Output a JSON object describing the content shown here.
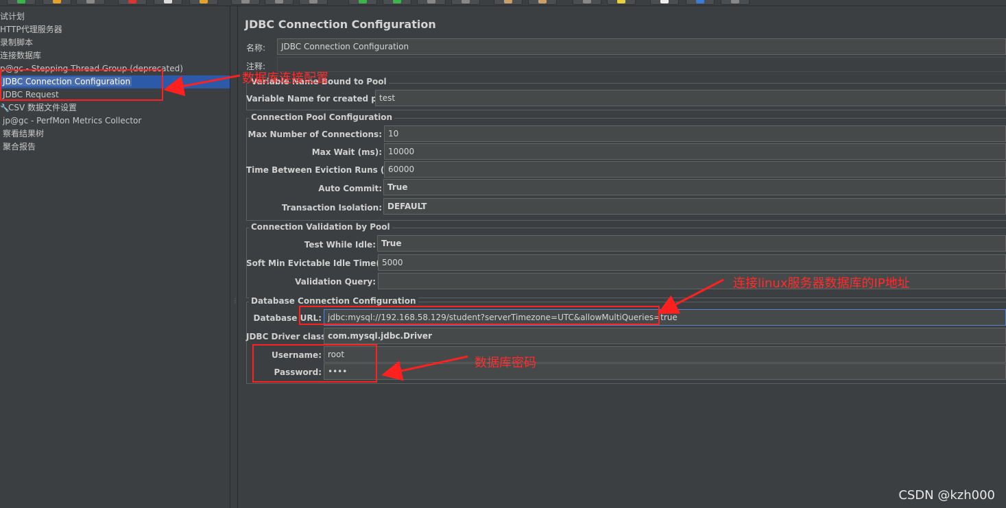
{
  "toolbar": {
    "buttons": [
      {
        "icon": "run-icon",
        "color": "#3bb54a"
      },
      {
        "icon": "folder-icon",
        "color": "#e8a227"
      },
      {
        "icon": "save-icon",
        "color": "#8a8a8a"
      },
      {
        "icon": "cut-icon",
        "color": "#d33"
      },
      {
        "icon": "copy-icon",
        "color": "#ddd"
      },
      {
        "icon": "paste-icon",
        "color": "#e8a227"
      },
      {
        "icon": "expand-icon",
        "color": "#888"
      },
      {
        "icon": "collapse-icon",
        "color": "#888"
      },
      {
        "icon": "toggle-icon",
        "color": "#888"
      },
      {
        "icon": "start-icon",
        "color": "#3bb54a"
      },
      {
        "icon": "start-no-pause-icon",
        "color": "#3bb54a"
      },
      {
        "icon": "stop-icon",
        "color": "#888"
      },
      {
        "icon": "shutdown-icon",
        "color": "#888"
      },
      {
        "icon": "broom-icon",
        "color": "#c9a06a"
      },
      {
        "icon": "clear-all-icon",
        "color": "#c9a06a"
      },
      {
        "icon": "search-icon",
        "color": "#888"
      },
      {
        "icon": "reset-search-icon",
        "color": "#e8d13b"
      },
      {
        "icon": "function-helper-icon",
        "color": "#eee"
      },
      {
        "icon": "help-icon",
        "color": "#3a7bd5"
      },
      {
        "icon": "log-icon",
        "color": "#888"
      }
    ]
  },
  "tree": {
    "items": [
      {
        "label": "试计划",
        "selected": false
      },
      {
        "label": "HTTP代理服务器",
        "selected": false
      },
      {
        "label": "录制脚本",
        "selected": false
      },
      {
        "label": "连接数据库",
        "selected": false
      },
      {
        "label": "p@gc - Stepping Thread Group (deprecated)",
        "selected": false
      },
      {
        "label": "JDBC Connection Configuration",
        "selected": true
      },
      {
        "label": "JDBC Request",
        "selected": false
      },
      {
        "label": "CSV 数据文件设置",
        "selected": false,
        "icon": "wrench-icon"
      },
      {
        "label": "jp@gc - PerfMon Metrics Collector",
        "selected": false
      },
      {
        "label": "察看结果树",
        "selected": false
      },
      {
        "label": "聚合报告",
        "selected": false
      }
    ]
  },
  "main": {
    "title": "JDBC Connection Configuration",
    "name_label": "名称:",
    "name_value": "JDBC Connection Configuration",
    "comment_label": "注释:",
    "pool_group": {
      "title": "Variable Name Bound to Pool",
      "var_label": "Variable Name for created pool:",
      "var_value": "test"
    },
    "conn_pool": {
      "title": "Connection Pool Configuration",
      "fields": [
        {
          "label": "Max Number of Connections:",
          "value": "10"
        },
        {
          "label": "Max Wait (ms):",
          "value": "10000"
        },
        {
          "label": "Time Between Eviction Runs (ms):",
          "value": "60000"
        },
        {
          "label": "Auto Commit:",
          "value": "True"
        },
        {
          "label": "Transaction Isolation:",
          "value": "DEFAULT"
        }
      ]
    },
    "validation": {
      "title": "Connection Validation by Pool",
      "fields": [
        {
          "label": "Test While Idle:",
          "value": "True"
        },
        {
          "label": "Soft Min Evictable Idle Time(ms):",
          "value": "5000"
        },
        {
          "label": "Validation Query:",
          "value": ""
        }
      ]
    },
    "db_conn": {
      "title": "Database Connection Configuration",
      "url_label": "Database URL:",
      "url_value": "jdbc:mysql://192.168.58.129/student?serverTimezone=UTC&allowMultiQueries=true",
      "driver_label": "JDBC Driver class:",
      "driver_value": "com.mysql.jdbc.Driver",
      "user_label": "Username:",
      "user_value": "root",
      "pass_label": "Password:",
      "pass_value": "••••"
    }
  },
  "annotations": {
    "config_note": "数据库连接配置",
    "ip_note": "连接linux服务器数据库的IP地址",
    "password_note": "数据库密码",
    "color": "#ff2020"
  },
  "watermark": "CSDN @kzh000"
}
